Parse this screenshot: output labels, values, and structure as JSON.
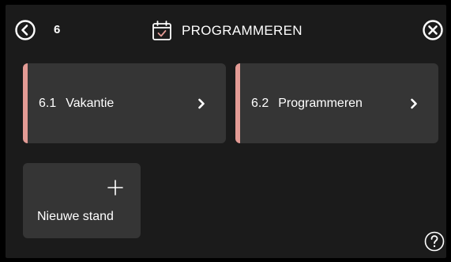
{
  "header": {
    "menu_number": "6",
    "title": "PROGRAMMEREN",
    "back_icon": "chevron-left-circle-icon",
    "title_icon": "calendar-check-icon",
    "close_icon": "close-circle-icon"
  },
  "tiles": [
    {
      "number": "6.1",
      "label": "Vakantie"
    },
    {
      "number": "6.2",
      "label": "Programmeren"
    }
  ],
  "new_tile": {
    "label": "Nieuwe stand",
    "icon": "plus-icon"
  },
  "help_icon": "help-circle-icon",
  "colors": {
    "background": "#1b1b1b",
    "tile": "#353535",
    "accent": "#e39b95",
    "calendar_check": "#e39b95"
  }
}
